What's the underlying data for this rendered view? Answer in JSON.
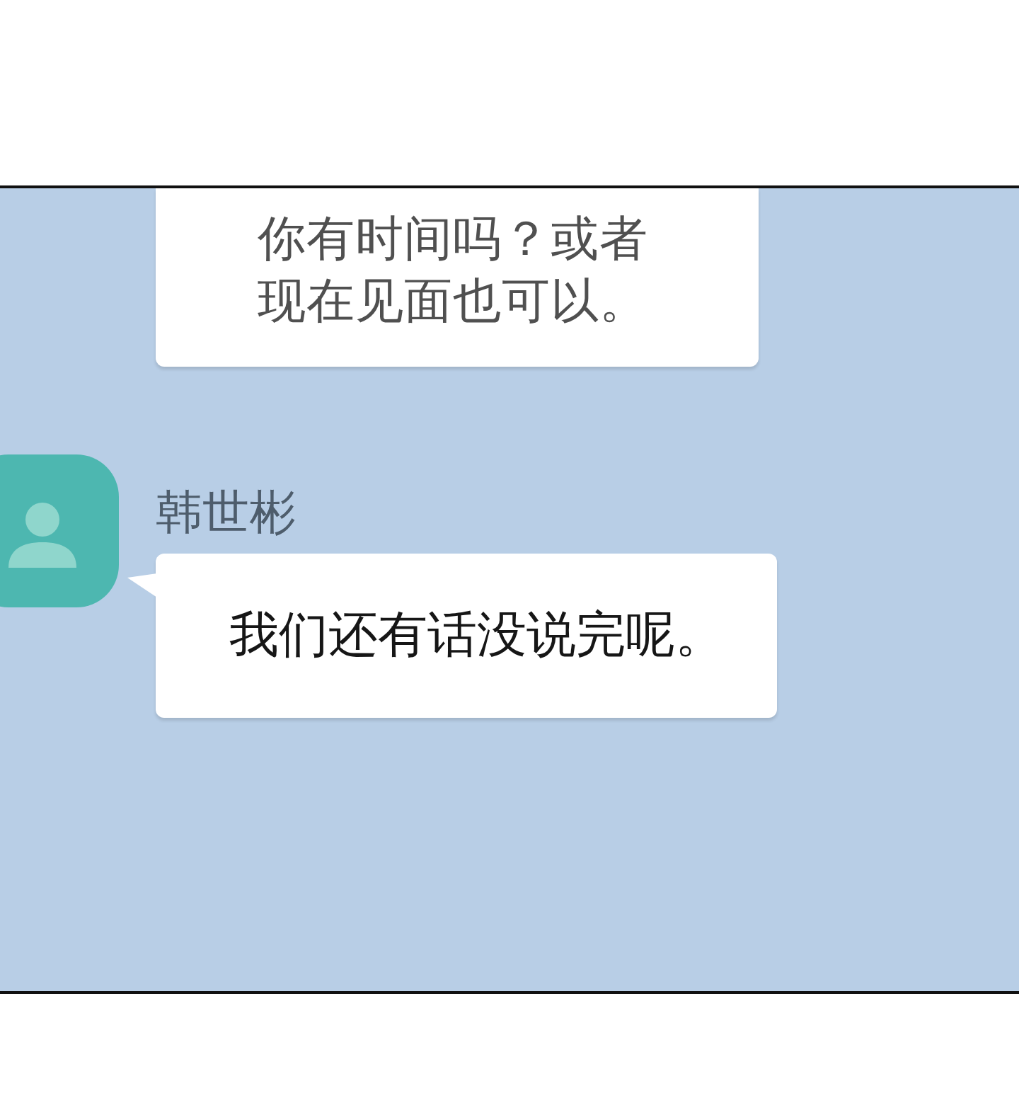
{
  "messages": [
    {
      "kind": "continued",
      "lines": [
        "你有时间吗？或者",
        "现在见面也可以。"
      ]
    },
    {
      "kind": "first",
      "sender": "韩世彬",
      "lines": [
        "我们还有话没说完呢。"
      ]
    }
  ]
}
